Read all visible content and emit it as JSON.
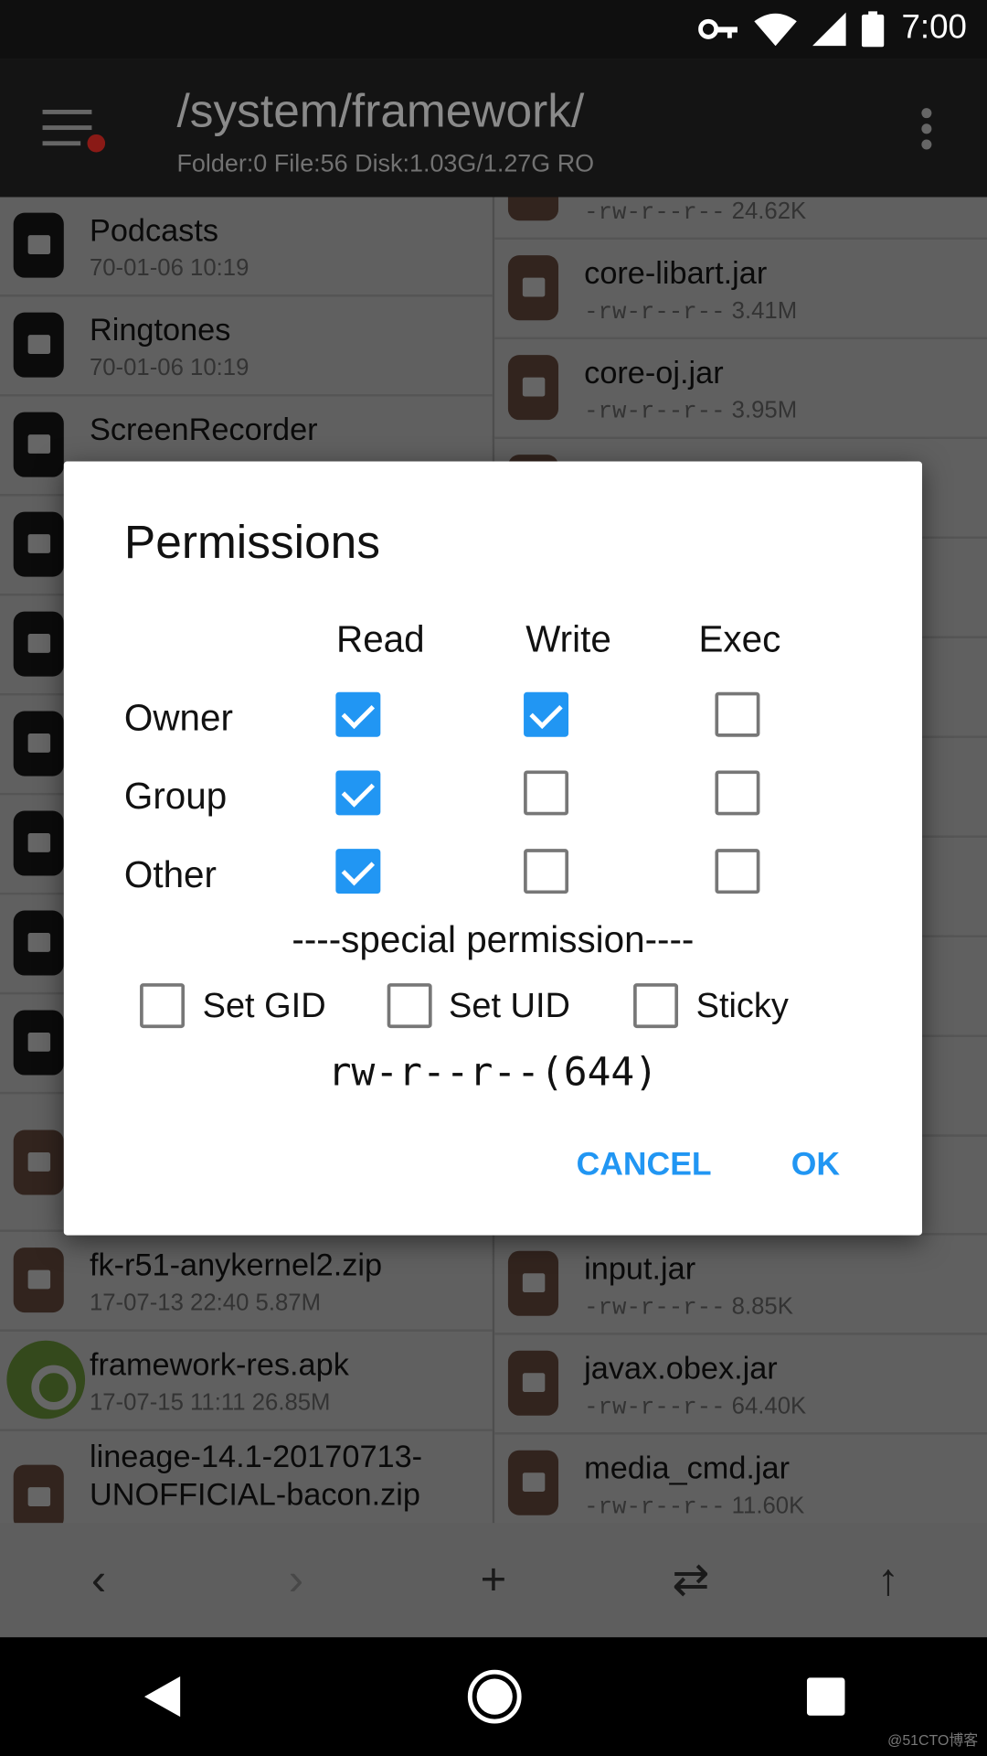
{
  "status_bar": {
    "time": "7:00",
    "icons": [
      "vpn-key-icon",
      "wifi-icon",
      "signal-icon",
      "battery-icon"
    ]
  },
  "toolbar": {
    "title": "/system/framework/",
    "subtitle": "Folder:0 File:56  Disk:1.03G/1.27G  RO"
  },
  "left_list": [
    {
      "name": "Podcasts",
      "meta": "70-01-06 10:19",
      "type": "folder"
    },
    {
      "name": "Ringtones",
      "meta": "70-01-06 10:19",
      "type": "folder"
    },
    {
      "name": "ScreenRecorder",
      "meta": "",
      "type": "folder"
    },
    {
      "name": "fk-r51-anykernel2.zip",
      "meta": "17-07-13 22:40  5.87M",
      "type": "archive"
    },
    {
      "name": "framework-res.apk",
      "meta": "17-07-15 11:11  26.85M",
      "type": "apk"
    },
    {
      "name": "lineage-14.1-20170713-UNOFFICIAL-bacon.zip",
      "meta": "",
      "type": "archive"
    }
  ],
  "right_list": [
    {
      "name": "",
      "perm": "-rw-r--r--",
      "size": "24.62K"
    },
    {
      "name": "core-libart.jar",
      "perm": "-rw-r--r--",
      "size": "3.41M"
    },
    {
      "name": "core-oj.jar",
      "perm": "-rw-r--r--",
      "size": "3.95M"
    },
    {
      "name": "input.jar",
      "perm": "-rw-r--r--",
      "size": "8.85K"
    },
    {
      "name": "javax.obex.jar",
      "perm": "-rw-r--r--",
      "size": "64.40K"
    },
    {
      "name": "media_cmd.jar",
      "perm": "-rw-r--r--",
      "size": "11.60K"
    }
  ],
  "bottom_bar": [
    "back-icon",
    "forward-icon",
    "add-icon",
    "swap-icon",
    "up-icon"
  ],
  "dialog": {
    "title": "Permissions",
    "columns": [
      "Read",
      "Write",
      "Exec"
    ],
    "rows": [
      {
        "label": "Owner",
        "values": [
          true,
          true,
          false
        ]
      },
      {
        "label": "Group",
        "values": [
          true,
          false,
          false
        ]
      },
      {
        "label": "Other",
        "values": [
          true,
          false,
          false
        ]
      }
    ],
    "special_label": "----special permission----",
    "special": [
      {
        "label": "Set GID",
        "checked": false
      },
      {
        "label": "Set UID",
        "checked": false
      },
      {
        "label": "Sticky",
        "checked": false
      }
    ],
    "permission_string": "rw-r--r--(644)",
    "cancel": "CANCEL",
    "ok": "OK",
    "accent": "#2196f3"
  },
  "watermark": "@51CTO博客"
}
